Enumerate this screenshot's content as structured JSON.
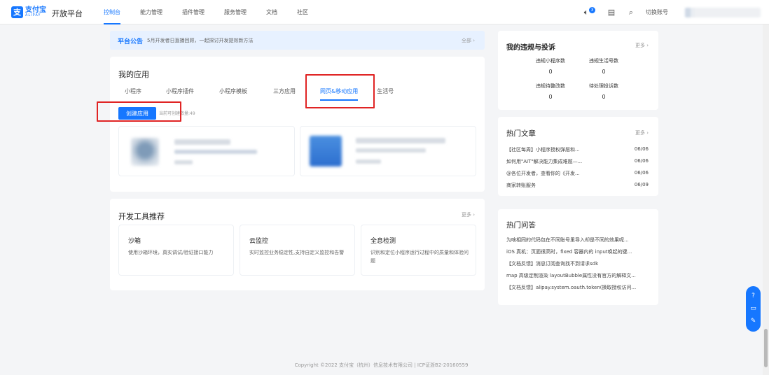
{
  "header": {
    "logo_cn": "支付宝",
    "logo_en": "ALIPAY",
    "platform": "开放平台",
    "nav": [
      "控制台",
      "能力管理",
      "插件管理",
      "服务管理",
      "文档",
      "社区"
    ],
    "message_count": "3",
    "switch_account": "切换账号"
  },
  "announcement": {
    "title": "平台公告",
    "text": "5月开发者日直播回顾，一起探讨开发提效新方法",
    "all": "全部"
  },
  "my_apps": {
    "title": "我的应用",
    "tabs": [
      "小程序",
      "小程序插件",
      "小程序模板",
      "三方应用",
      "网页&移动应用",
      "生活号"
    ],
    "active_tab": 4,
    "create_button": "创建应用",
    "quota": "当前可创建数量:49"
  },
  "dev_tools": {
    "title": "开发工具推荐",
    "more": "更多",
    "tools": [
      {
        "name": "沙箱",
        "desc": "使用沙箱环境，真实调试/验证接口能力"
      },
      {
        "name": "云监控",
        "desc": "实时监控业务稳定性,支持自定义监控和告警"
      },
      {
        "name": "全息检测",
        "desc": "识别和定位小程序运行过程中的质量和体验问题"
      }
    ]
  },
  "violations": {
    "title": "我的违规与投诉",
    "more": "更多",
    "stats": [
      {
        "label": "违规小程序数",
        "value": "0"
      },
      {
        "label": "违规生活号数",
        "value": "0"
      },
      {
        "label": "违规待整改数",
        "value": "0"
      },
      {
        "label": "待处理投诉数",
        "value": "0"
      }
    ]
  },
  "hot_articles": {
    "title": "热门文章",
    "more": "更多",
    "items": [
      {
        "text": "【社区每周】小程序授权弹层和...",
        "date": "06/06"
      },
      {
        "text": "如何用\"AIT\"解决能力集成难题—...",
        "date": "06/06"
      },
      {
        "text": "@各位开发者，查看你的《开发...",
        "date": "06/06"
      },
      {
        "text": "商家转账服务",
        "date": "06/09"
      }
    ]
  },
  "hot_qa": {
    "title": "热门问答",
    "items": [
      "为啥相同的代码包在不同账号里导入却是不同的效果呢...",
      "iOS 真机：页面很高时，fixed 容器内的 input唤起的键...",
      "【文档反馈】消息订阅查询找不到请求sdk",
      "map 高级定制渲染 layoutBubble属性没有官方的解释文...",
      "【文档反馈】alipay.system.oauth.token(换取授权访问..."
    ]
  },
  "footer": "Copyright ©2022 支付宝（杭州）信息技术有限公司 | ICP证浙B2-20160559",
  "colors": {
    "accent": "#1677ff",
    "highlight": "#e02424"
  }
}
